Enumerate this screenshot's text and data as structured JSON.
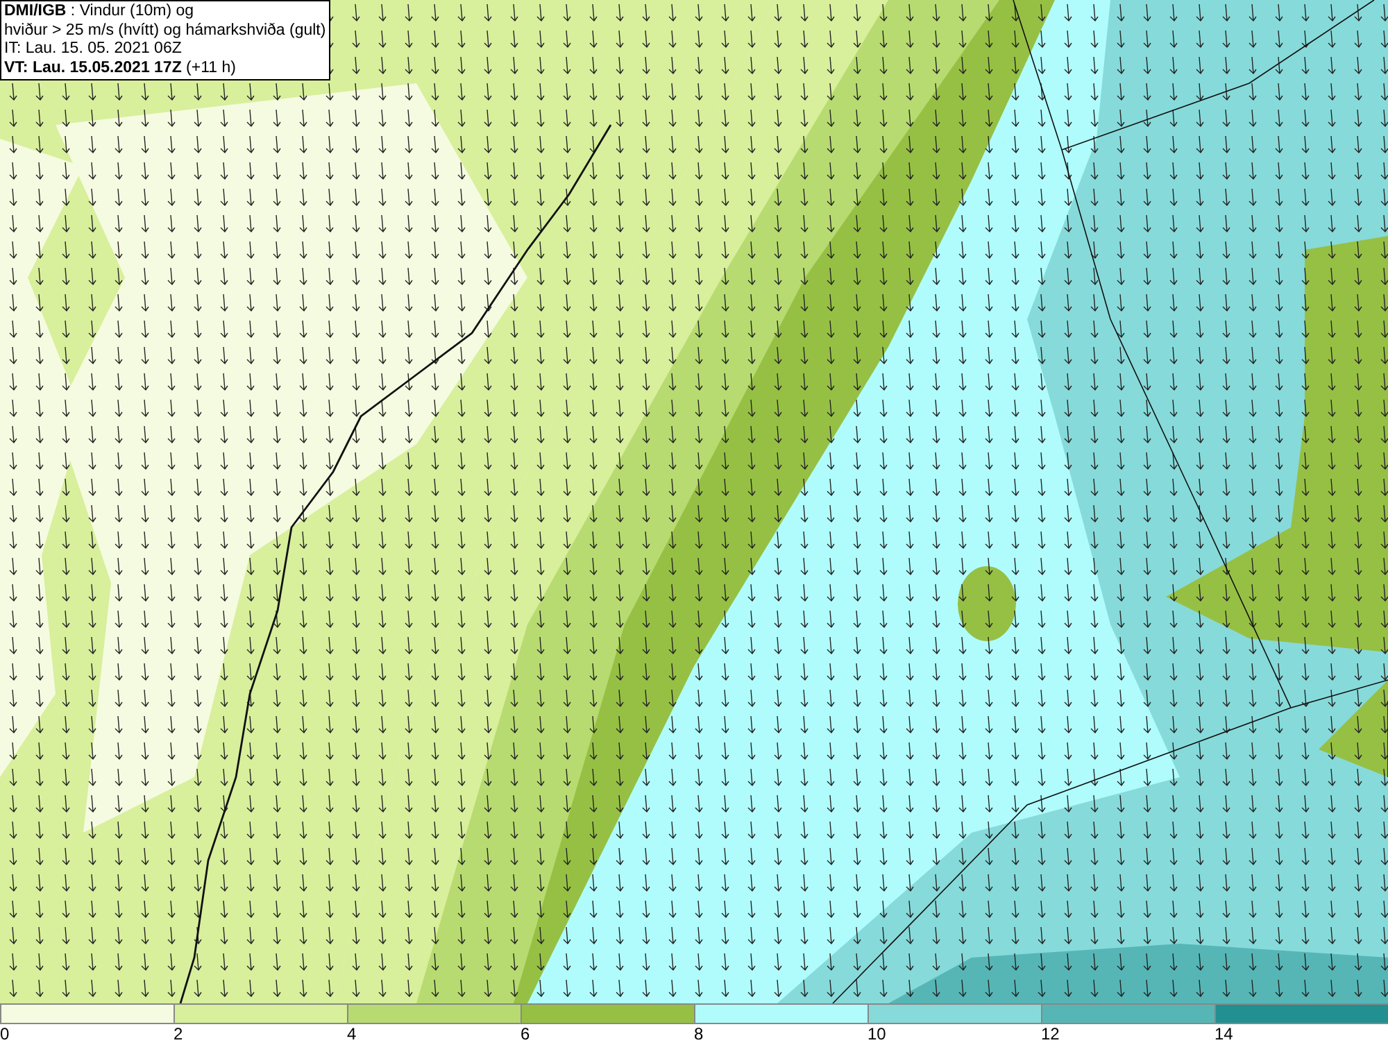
{
  "header": {
    "lines": [
      "**DMI/IGB** : Vindur (10m) og",
      "hviður > 25 m/s (hvítt) og hámarkshviða (gult)",
      "IT: Lau. 15. 05. 2021 06Z",
      "**VT: Lau. 15.05.2021 17Z** (+11 h)"
    ]
  },
  "legend": [
    {
      "label": "0",
      "color": "#f5fbe0"
    },
    {
      "label": "2",
      "color": "#d8ef9c"
    },
    {
      "label": "4",
      "color": "#b7db70"
    },
    {
      "label": "6",
      "color": "#96c044"
    },
    {
      "label": "8",
      "color": "#b0fcfd"
    },
    {
      "label": "10",
      "color": "#87dada"
    },
    {
      "label": "12",
      "color": "#56b6b6"
    },
    {
      "label": "14",
      "color": "#229090"
    }
  ]
}
